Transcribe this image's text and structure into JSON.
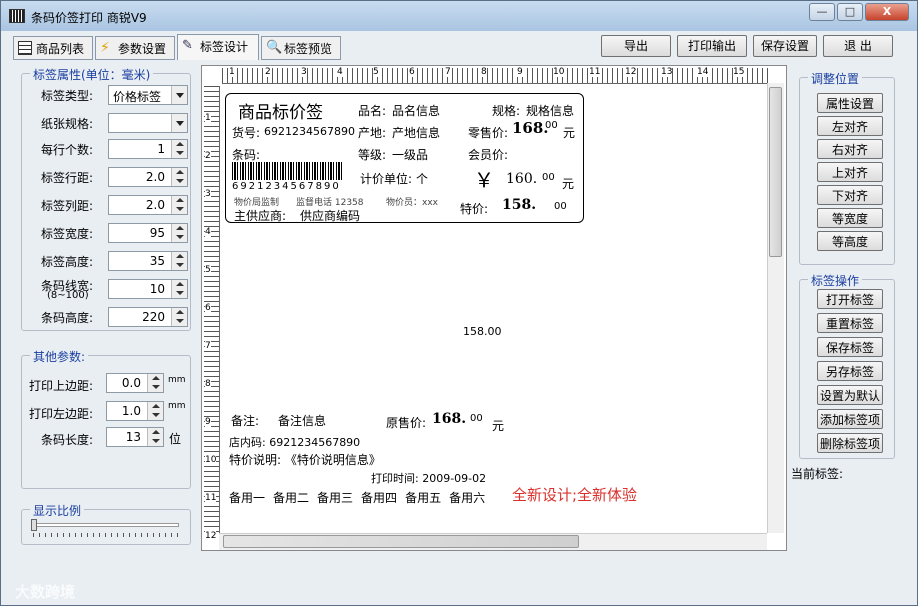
{
  "window": {
    "title": "条码价签打印 商锐V9",
    "min": "—",
    "max": "□",
    "close": "X"
  },
  "tabs": [
    {
      "label": "商品列表"
    },
    {
      "label": "参数设置"
    },
    {
      "label": "标签设计"
    },
    {
      "label": "标签预览"
    }
  ],
  "toolbar": {
    "export": "导出",
    "print": "打印输出",
    "save": "保存设置",
    "exit": "退 出"
  },
  "label_props": {
    "title": "标签属性(单位：毫米)",
    "type_label": "标签类型:",
    "type_value": "价格标签",
    "paper_label": "纸张规格:",
    "paper_value": "",
    "per_row_label": "每行个数:",
    "per_row_value": "1",
    "row_gap_label": "标签行距:",
    "row_gap_value": "2.0",
    "col_gap_label": "标签列距:",
    "col_gap_value": "2.0",
    "width_label": "标签宽度:",
    "width_value": "95",
    "height_label": "标签高度:",
    "height_value": "35",
    "bar_width_label": "条码线宽:",
    "bar_width_range": "(8~100)",
    "bar_width_value": "10",
    "bar_height_label": "条码高度:",
    "bar_height_value": "220"
  },
  "other": {
    "title": "其他参数:",
    "top_label": "打印上边距:",
    "top_value": "0.0",
    "top_unit": "mm",
    "left_label": "打印左边距:",
    "left_value": "1.0",
    "left_unit": "mm",
    "len_label": "条码长度:",
    "len_value": "13",
    "len_unit": "位"
  },
  "scale": {
    "title": "显示比例"
  },
  "adjust": {
    "title": "调整位置",
    "buttons": [
      "属性设置",
      "左对齐",
      "右对齐",
      "上对齐",
      "下对齐",
      "等宽度",
      "等高度"
    ]
  },
  "ops": {
    "title": "标签操作",
    "buttons": [
      "打开标签",
      "重置标签",
      "保存标签",
      "另存标签",
      "设置为默认",
      "添加标签项",
      "删除标签项"
    ]
  },
  "current_label": "当前标签:",
  "ruler_h": [
    "1",
    "2",
    "3",
    "4",
    "5",
    "6",
    "7",
    "8",
    "9",
    "10",
    "11",
    "12",
    "13",
    "14",
    "15"
  ],
  "ruler_v": [
    "1",
    "2",
    "3",
    "4",
    "5",
    "6",
    "7",
    "8",
    "9",
    "10",
    "11",
    "12"
  ],
  "tag": {
    "title": "商品标价签",
    "name_label": "品名:",
    "name_value": "品名信息",
    "spec_label": "规格:",
    "spec_value": "规格信息",
    "sku_label": "货号:",
    "sku_value": "6921234567890",
    "origin_label": "产地:",
    "origin_value": "产地信息",
    "retail_label": "零售价:",
    "retail_value": "168.",
    "retail_dec": "00",
    "retail_unit": "元",
    "barcode_label": "条码:",
    "grade_label": "等级:",
    "grade_value": "一级品",
    "member_label": "会员价:",
    "barcode_digits": "6921234567890",
    "unit_label": "计价单位:",
    "unit_value": "个",
    "yen": "￥",
    "member_value": "160.",
    "member_dec": "00",
    "member_unit": "元",
    "supervise": "物价局监制",
    "hotline": "监督电话 12358",
    "clerk": "物价员：xxx",
    "special_label": "特价:",
    "special_value": "158.",
    "special_dec": "00",
    "supplier_label": "主供应商:",
    "supplier_value": "供应商编码"
  },
  "free_text": {
    "price": "158.00",
    "remark_label": "备注:",
    "remark_value": "备注信息",
    "orig_label": "原售价:",
    "orig_value": "168.",
    "orig_dec": "00",
    "orig_unit": "元",
    "store_code": "店内码: 6921234567890",
    "special_desc": "特价说明: 《特价说明信息》",
    "print_time": "打印时间: 2009-09-02",
    "spares": [
      "备用一",
      "备用二",
      "备用三",
      "备用四",
      "备用五",
      "备用六"
    ],
    "slogan": "全新设计;全新体验"
  },
  "watermark": "大数跨境",
  "colors": {
    "accent": "#1a3fa0",
    "slogan": "#d9302c"
  }
}
